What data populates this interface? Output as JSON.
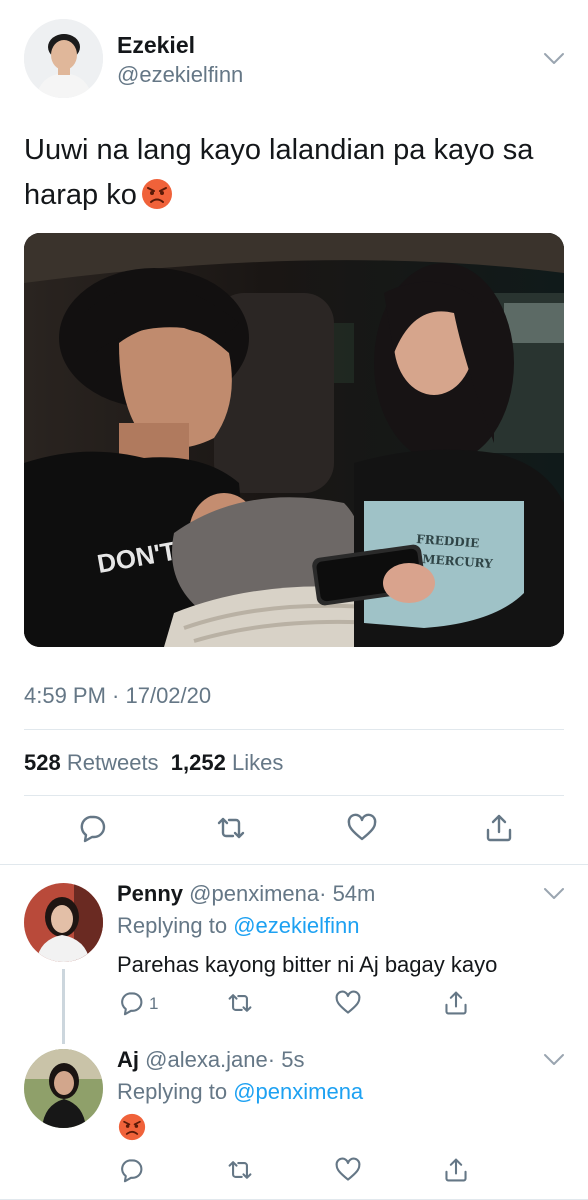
{
  "tweet": {
    "author_name": "Ezekiel",
    "author_handle": "@ezekielfinn",
    "text": "Uuwi na lang kayo lalandian pa kayo sa harap ko",
    "emoji": "angry-face-emoji",
    "media_shirt_left": "DON'T",
    "media_shirt_right_1": "FREDDIE",
    "media_shirt_right_2": "MERCURY",
    "timestamp": "4:59 PM · 17/02/20",
    "retweets_count": "528",
    "retweets_label": "Retweets",
    "likes_count": "1,252",
    "likes_label": "Likes"
  },
  "replies": [
    {
      "name": "Penny",
      "handle": "@penximena",
      "time": "· 54m",
      "replying_prefix": "Replying to",
      "replying_to": "@ezekielfinn",
      "text": "Parehas kayong bitter ni Aj bagay kayo",
      "reply_count": "1"
    },
    {
      "name": "Aj",
      "handle": "@alexa.jane",
      "time": "· 5s",
      "replying_prefix": "Replying to",
      "replying_to": "@penximena",
      "emoji": "angry-face-emoji"
    }
  ],
  "icons": {
    "more": "chevron-down-icon",
    "reply": "reply-bubble-icon",
    "retweet": "retweet-icon",
    "like": "heart-icon",
    "share": "share-icon"
  },
  "colors": {
    "text": "#14171a",
    "secondary": "#657786",
    "link": "#1da1f2",
    "divider": "#e1e8ed",
    "icon": "#657786"
  }
}
